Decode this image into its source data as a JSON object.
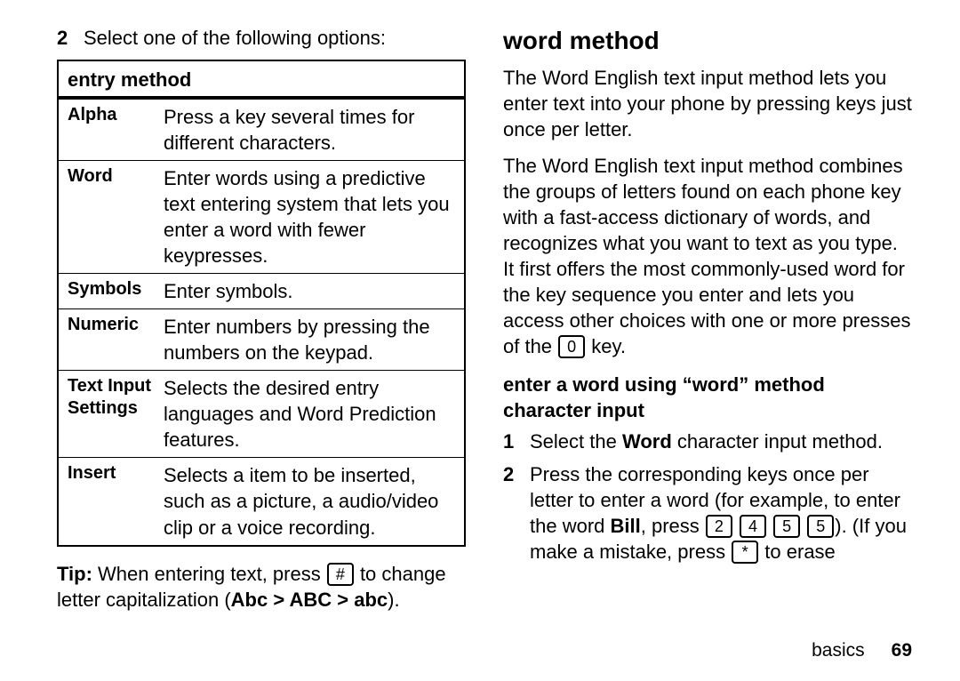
{
  "left": {
    "step2_num": "2",
    "step2_text": "Select one of the following options:",
    "table_header": "entry method",
    "rows": [
      {
        "label": "Alpha",
        "desc": "Press a key several times for different characters."
      },
      {
        "label": "Word",
        "desc": "Enter words using a predictive text entering system that lets you enter a word with fewer keypresses."
      },
      {
        "label": "Symbols",
        "desc": "Enter symbols."
      },
      {
        "label": "Numeric",
        "desc": "Enter numbers by pressing the numbers on the keypad."
      },
      {
        "label": "Text Input Settings",
        "desc": "Selects the desired entry languages and Word Prediction features."
      },
      {
        "label": "Insert",
        "desc": "Selects a item to be inserted, such as a picture, a audio/video clip or a voice recording."
      }
    ],
    "tip_label": "Tip:",
    "tip_before_key": " When entering text, press ",
    "tip_key": "#",
    "tip_after_key": " to change letter capitalization (",
    "tip_caps": "Abc > ABC > abc",
    "tip_end": ")."
  },
  "right": {
    "heading": "word method",
    "p1": "The Word English text input method lets you enter text into your phone by pressing keys just once per letter.",
    "p2_before_key": "The Word English text input method combines the groups of letters found on each phone key with a fast-access dictionary of words, and recognizes what you want to text as you type. It first offers the most commonly-used word for the key sequence you enter and lets you access other choices with one or more presses of the ",
    "p2_key": "0",
    "p2_after_key": " key.",
    "subheading": "enter a word using “word” method character input",
    "step1_num": "1",
    "step1_a": "Select the ",
    "step1_bold": "Word",
    "step1_b": " character input method.",
    "step2_num": "2",
    "step2_a": "Press the corresponding keys once per letter to enter a word (for example, to enter the word ",
    "step2_bold": "Bill",
    "step2_b": ", press ",
    "step2_keys": [
      "2",
      "4",
      "5",
      "5"
    ],
    "step2_c": "). (If you make a mistake, press ",
    "step2_erasekey": "*",
    "step2_d": " to erase"
  },
  "footer": {
    "section": "basics",
    "page": "69"
  }
}
